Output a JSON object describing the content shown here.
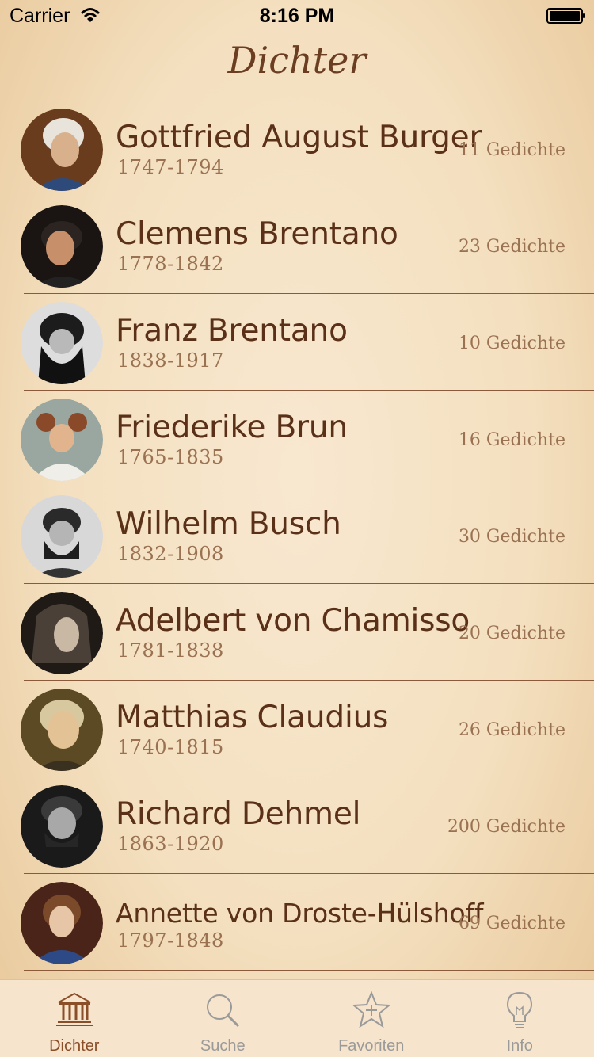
{
  "status_bar": {
    "carrier": "Carrier",
    "time": "8:16 PM"
  },
  "nav": {
    "title": "Dichter"
  },
  "poets": [
    {
      "name": "Gottfried August Burger",
      "years": "1747-1794",
      "count": "11 Gedichte"
    },
    {
      "name": "Clemens Brentano",
      "years": "1778-1842",
      "count": "23 Gedichte"
    },
    {
      "name": "Franz Brentano",
      "years": "1838-1917",
      "count": "10 Gedichte"
    },
    {
      "name": "Friederike Brun",
      "years": "1765-1835",
      "count": "16 Gedichte"
    },
    {
      "name": "Wilhelm Busch",
      "years": "1832-1908",
      "count": "30 Gedichte"
    },
    {
      "name": "Adelbert von Chamisso",
      "years": "1781-1838",
      "count": "20 Gedichte"
    },
    {
      "name": "Matthias Claudius",
      "years": "1740-1815",
      "count": "26 Gedichte"
    },
    {
      "name": "Richard Dehmel",
      "years": "1863-1920",
      "count": "200 Gedichte"
    },
    {
      "name": "Annette von Droste-Hülshoff",
      "years": "1797-1848",
      "count": "69 Gedichte"
    }
  ],
  "tabs": [
    {
      "label": "Dichter",
      "icon": "museum-icon",
      "active": true
    },
    {
      "label": "Suche",
      "icon": "search-icon",
      "active": false
    },
    {
      "label": "Favoriten",
      "icon": "star-plus-icon",
      "active": false
    },
    {
      "label": "Info",
      "icon": "lightbulb-icon",
      "active": false
    }
  ],
  "colors": {
    "accent": "#8a4e28",
    "title": "#6b3e22",
    "name": "#5a3018",
    "muted": "#9a7252",
    "inactive_tab": "#9a9a9a"
  }
}
